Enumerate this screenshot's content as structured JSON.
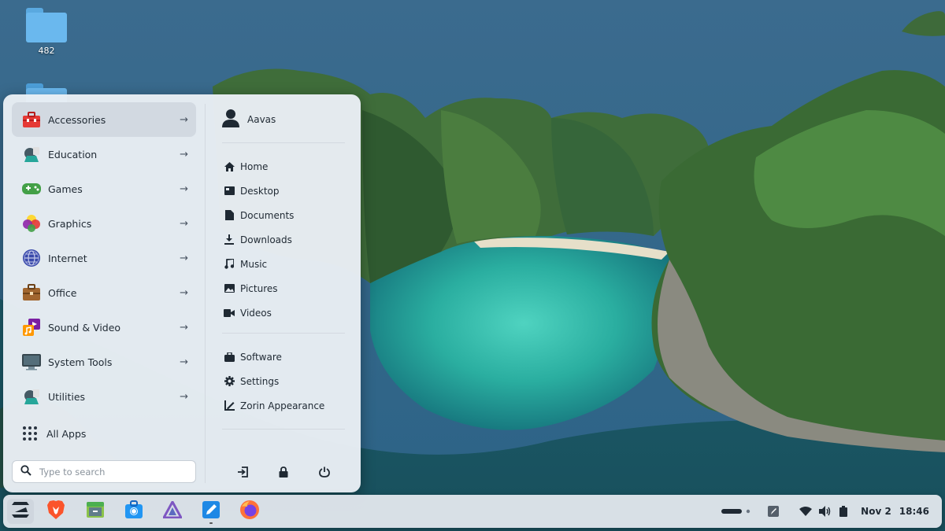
{
  "desktop": {
    "icons": [
      {
        "label": "482",
        "icon": "folder-icon"
      }
    ]
  },
  "menu": {
    "categories": [
      {
        "label": "Accessories",
        "icon": "toolbox-icon",
        "active": true
      },
      {
        "label": "Education",
        "icon": "education-icon"
      },
      {
        "label": "Games",
        "icon": "gamepad-icon"
      },
      {
        "label": "Graphics",
        "icon": "graphics-icon"
      },
      {
        "label": "Internet",
        "icon": "globe-icon"
      },
      {
        "label": "Office",
        "icon": "briefcase-icon"
      },
      {
        "label": "Sound & Video",
        "icon": "media-icon"
      },
      {
        "label": "System Tools",
        "icon": "monitor-icon"
      },
      {
        "label": "Utilities",
        "icon": "utilities-icon"
      }
    ],
    "all_apps_label": "All Apps",
    "search_placeholder": "Type to search",
    "user_name": "Aavas",
    "places": [
      {
        "label": "Home",
        "icon": "home-icon"
      },
      {
        "label": "Desktop",
        "icon": "desktop-icon"
      },
      {
        "label": "Documents",
        "icon": "document-icon"
      },
      {
        "label": "Downloads",
        "icon": "download-icon"
      },
      {
        "label": "Music",
        "icon": "music-icon"
      },
      {
        "label": "Pictures",
        "icon": "picture-icon"
      },
      {
        "label": "Videos",
        "icon": "video-icon"
      }
    ],
    "system": [
      {
        "label": "Software",
        "icon": "software-icon"
      },
      {
        "label": "Settings",
        "icon": "gear-icon"
      },
      {
        "label": "Zorin Appearance",
        "icon": "appearance-icon"
      }
    ],
    "power_actions": [
      "logout-icon",
      "lock-icon",
      "power-icon"
    ]
  },
  "taskbar": {
    "apps": [
      {
        "name": "Zorin Menu",
        "icon": "zorin-logo-icon"
      },
      {
        "name": "Brave",
        "icon": "brave-icon"
      },
      {
        "name": "Files",
        "icon": "files-icon"
      },
      {
        "name": "Software",
        "icon": "software-store-icon"
      },
      {
        "name": "Prism",
        "icon": "prism-icon"
      },
      {
        "name": "Text Editor",
        "icon": "text-editor-icon"
      },
      {
        "name": "Firefox",
        "icon": "firefox-icon"
      }
    ],
    "date": "Nov 2",
    "time": "18:46"
  },
  "colors": {
    "menu_bg": "#e9eef4",
    "accent_active": "#d2d9e1",
    "text": "#1f2933"
  }
}
